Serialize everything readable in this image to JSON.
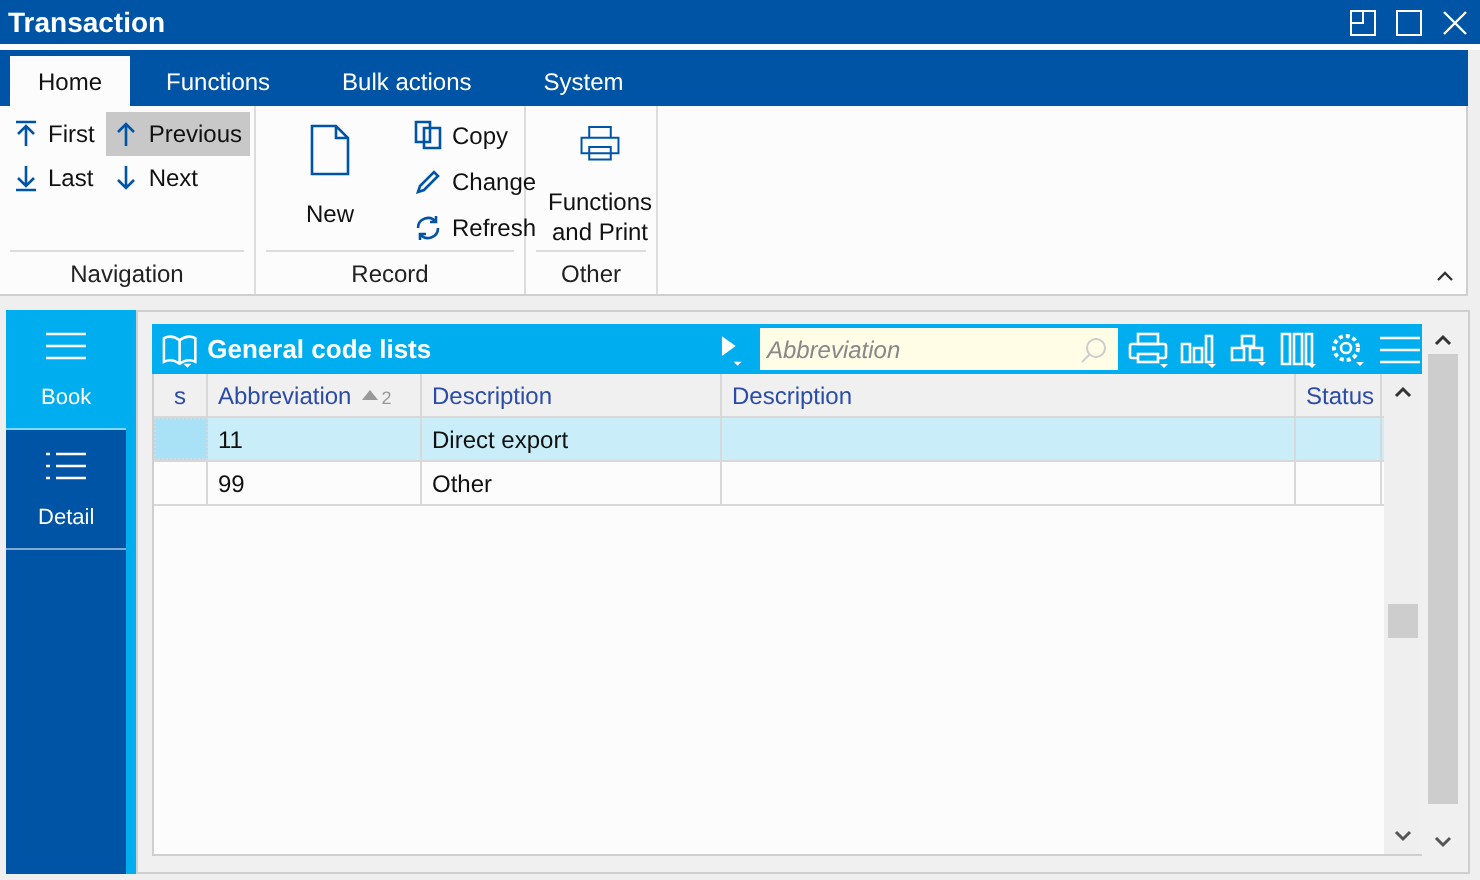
{
  "window": {
    "title": "Transaction"
  },
  "tabs": [
    {
      "label": "Home",
      "selected": true
    },
    {
      "label": "Functions",
      "selected": false
    },
    {
      "label": "Bulk actions",
      "selected": false
    },
    {
      "label": "System",
      "selected": false
    }
  ],
  "ribbon": {
    "groups": [
      {
        "label": "Navigation",
        "buttons": [
          {
            "kind": "first",
            "label": "First",
            "highlighted": false
          },
          {
            "kind": "previous",
            "label": "Previous",
            "highlighted": true
          },
          {
            "kind": "last",
            "label": "Last",
            "highlighted": false
          },
          {
            "kind": "next",
            "label": "Next",
            "highlighted": false
          }
        ]
      },
      {
        "label": "Record",
        "buttons": [
          {
            "kind": "new",
            "label": "New",
            "highlighted": false
          },
          {
            "kind": "copy",
            "label": "Copy",
            "highlighted": false
          },
          {
            "kind": "change",
            "label": "Change",
            "highlighted": false
          },
          {
            "kind": "refresh",
            "label": "Refresh",
            "highlighted": false
          }
        ]
      },
      {
        "label": "Other",
        "buttons": [
          {
            "kind": "print",
            "label": "Functions and Print",
            "highlighted": false
          }
        ]
      }
    ]
  },
  "side_panel": {
    "items": [
      {
        "kind": "book",
        "label": "Book",
        "selected": true
      },
      {
        "kind": "detail",
        "label": "Detail",
        "selected": false
      }
    ]
  },
  "list": {
    "title": "General code lists",
    "search": {
      "placeholder": "Abbreviation"
    },
    "columns": [
      {
        "label": "s"
      },
      {
        "label": "Abbreviation",
        "sort_order": "2"
      },
      {
        "label": "Description"
      },
      {
        "label": "Description"
      },
      {
        "label": "Status"
      }
    ],
    "rows": [
      {
        "selected": true,
        "abbreviation": "11",
        "description": "Direct export"
      },
      {
        "selected": false,
        "abbreviation": "99",
        "description": "Other"
      }
    ]
  }
}
